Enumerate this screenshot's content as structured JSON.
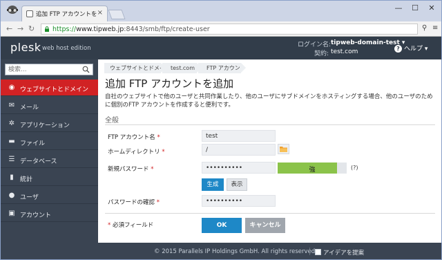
{
  "browser": {
    "tab_title": "追加 FTP アカウントを追加",
    "tab_close": "×",
    "url_https": "https://",
    "url_host": "www.tipweb.jp",
    "url_rest": ":8443/smb/ftp/create-user",
    "minimize": "—",
    "maximize": "☐",
    "close": "✕"
  },
  "header": {
    "logo": "plesk",
    "edition": "web host edition",
    "login_label": "ログイン名:",
    "login_value": "tipweb-domain-test ▾",
    "subscription_label": "契約:",
    "subscription_value": "test.com",
    "help_label": "ヘルプ ▾"
  },
  "sidebar": {
    "search_placeholder": "検索...",
    "items": [
      {
        "label": "ウェブサイトとドメイン",
        "icon": "globe-icon",
        "glyph": "◉",
        "active": true
      },
      {
        "label": "メール",
        "icon": "mail-icon",
        "glyph": "✉",
        "active": false
      },
      {
        "label": "アプリケーション",
        "icon": "gear-icon",
        "glyph": "✲",
        "active": false
      },
      {
        "label": "ファイル",
        "icon": "folder-icon",
        "glyph": "▬",
        "active": false
      },
      {
        "label": "データベース",
        "icon": "database-icon",
        "glyph": "☰",
        "active": false
      },
      {
        "label": "統計",
        "icon": "bar-chart-icon",
        "glyph": "▮",
        "active": false
      },
      {
        "label": "ユーザ",
        "icon": "user-icon",
        "glyph": "●",
        "active": false
      },
      {
        "label": "アカウント",
        "icon": "account-card-icon",
        "glyph": "▣",
        "active": false
      }
    ]
  },
  "breadcrumbs": [
    "ウェブサイトとドメイン",
    "test.com",
    "FTP アカウント"
  ],
  "page": {
    "title": "追加 FTP アカウントを追加",
    "description": "自社のウェブサイトで他のユーザと共同作業したり、他のユーザにサブドメインをホスティングする場合、他のユーザのために個別のFTP アカウントを作成すると便利です。",
    "section": "全般"
  },
  "form": {
    "ftp_name_label": "FTP アカウント名",
    "ftp_name_value": "test",
    "home_dir_label": "ホームディレクトリ",
    "home_dir_value": "/",
    "password_label": "新規パスワード",
    "password_value": "••••••••••",
    "strength_label": "強",
    "strength_level": 0.86,
    "strength_color": "#8bc34a",
    "help_mark": "(?)",
    "generate_label": "生成",
    "show_label": "表示",
    "confirm_label": "パスワードの確認",
    "confirm_value": "••••••••••",
    "required_star": "*",
    "required_note": "必須フィールド",
    "ok_label": "OK",
    "cancel_label": "キャンセル"
  },
  "footer": {
    "copyright": "© 2015 Parallels IP Holdings GmbH. All rights reserved.",
    "idea_label": "アイデアを提案"
  },
  "colors": {
    "accent": "#1e88c7",
    "active_nav": "#d12224",
    "header_bg": "#323d4a"
  }
}
